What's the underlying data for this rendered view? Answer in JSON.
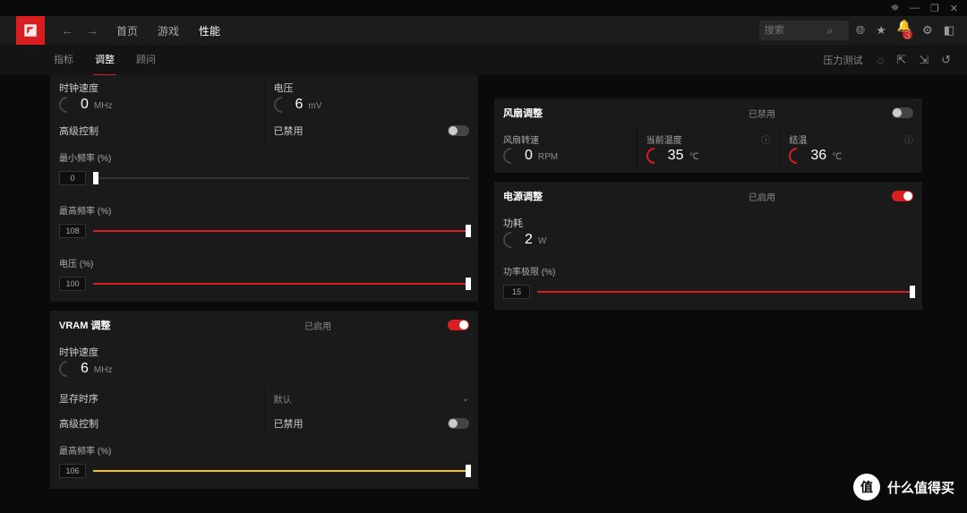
{
  "sysbar": {
    "bug": "⚙",
    "min": "—",
    "max": "❐",
    "close": "✕"
  },
  "header": {
    "nav_back": "←",
    "nav_fwd": "→",
    "tabs": {
      "home": "首页",
      "games": "游戏",
      "perf": "性能"
    },
    "search_placeholder": "搜索",
    "bell_badge": "3"
  },
  "subhdr": {
    "tabs": {
      "metrics": "指标",
      "tuning": "调整",
      "advisor": "顾问"
    },
    "stress_test": "压力测试"
  },
  "gpu": {
    "clock_label": "时钟速度",
    "clock_val": "0",
    "clock_unit": "MHz",
    "volt_label": "电压",
    "volt_val": "6",
    "volt_unit": "mV",
    "adv_ctrl": "高级控制",
    "adv_state": "已禁用",
    "min_freq_label": "最小频率 (%)",
    "min_freq_val": "0",
    "max_freq_label": "最高频率 (%)",
    "max_freq_val": "108",
    "volt_pct_label": "电压 (%)",
    "volt_pct_val": "100"
  },
  "vram": {
    "title": "VRAM 调整",
    "state": "已启用",
    "clock_label": "时钟速度",
    "clock_val": "6",
    "clock_unit": "MHz",
    "timing_label": "显存时序",
    "timing_val": "默认",
    "adv_ctrl": "高级控制",
    "adv_state": "已禁用",
    "max_freq_label": "最高频率 (%)",
    "max_freq_val": "106"
  },
  "fan": {
    "title": "风扇调整",
    "state": "已禁用",
    "speed_label": "风扇转速",
    "speed_val": "0",
    "speed_unit": "RPM",
    "cur_temp_label": "当前温度",
    "cur_temp_val": "35",
    "cur_temp_unit": "℃",
    "junc_label": "结温",
    "junc_val": "36",
    "junc_unit": "℃"
  },
  "power": {
    "title": "电源调整",
    "state": "已启用",
    "pwr_label": "功耗",
    "pwr_val": "2",
    "pwr_unit": "W",
    "limit_label": "功率极限 (%)",
    "limit_val": "15"
  },
  "watermark": {
    "icon": "值",
    "text": "什么值得买"
  }
}
